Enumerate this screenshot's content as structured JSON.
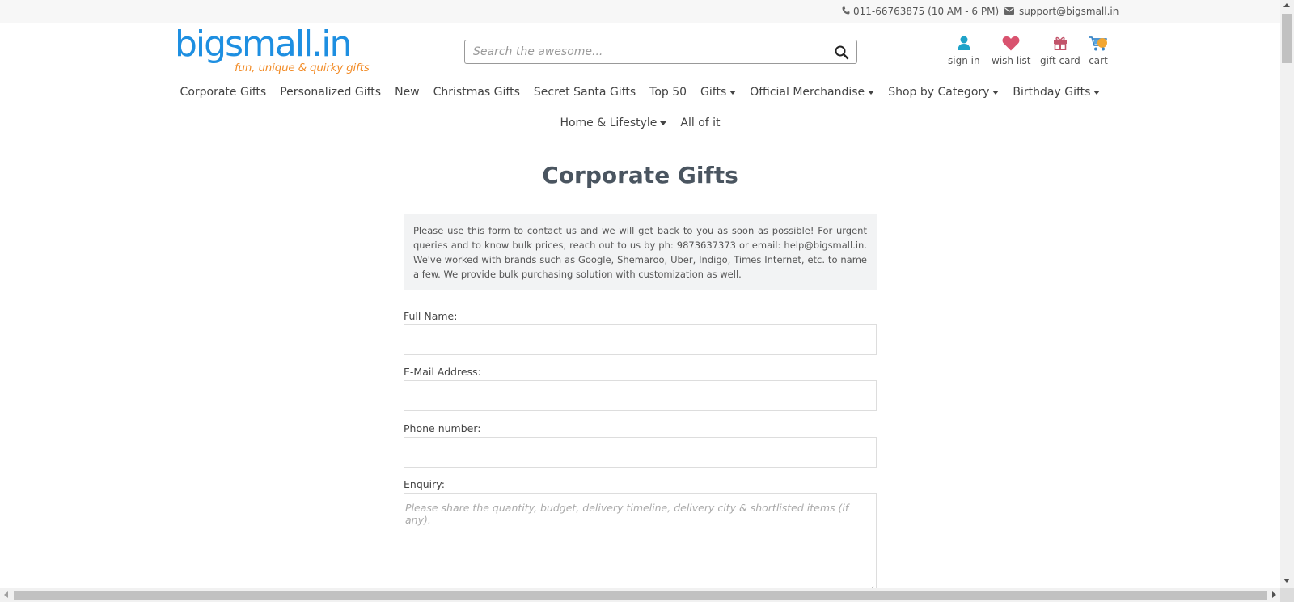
{
  "topbar": {
    "phone": "011-66763875 (10 AM - 6 PM)",
    "email": "support@bigsmall.in"
  },
  "logo": {
    "name": "bigsmall.in",
    "tagline": "fun, unique & quirky gifts"
  },
  "search": {
    "placeholder": "Search the awesome..."
  },
  "quick_links": {
    "sign_in": "sign in",
    "wish_list": "wish list",
    "gift_card": "gift card",
    "cart": "cart"
  },
  "nav": {
    "row1": [
      {
        "label": "Corporate Gifts",
        "dropdown": false
      },
      {
        "label": "Personalized Gifts",
        "dropdown": false
      },
      {
        "label": "New",
        "dropdown": false
      },
      {
        "label": "Christmas Gifts",
        "dropdown": false
      },
      {
        "label": "Secret Santa Gifts",
        "dropdown": false
      },
      {
        "label": "Top 50",
        "dropdown": false
      },
      {
        "label": "Gifts",
        "dropdown": true
      },
      {
        "label": "Official Merchandise",
        "dropdown": true
      },
      {
        "label": "Shop by Category",
        "dropdown": true
      },
      {
        "label": "Birthday Gifts",
        "dropdown": true
      }
    ],
    "row2": [
      {
        "label": "Home & Lifestyle",
        "dropdown": true
      },
      {
        "label": "All of it",
        "dropdown": false
      }
    ]
  },
  "page": {
    "title": "Corporate Gifts",
    "intro": "Please use this form to contact us and we will get back to you as soon as possible! For urgent queries and to know bulk prices, reach out to us by ph: 9873637373 or email: help@bigsmall.in. We've worked with brands such as Google, Shemaroo, Uber, Indigo, Times Internet, etc. to name a few. We provide bulk purchasing solution with customization as well."
  },
  "form": {
    "full_name_label": "Full Name:",
    "full_name_value": "",
    "email_label": "E-Mail Address:",
    "email_value": "",
    "phone_label": "Phone number:",
    "phone_value": "",
    "enquiry_label": "Enquiry:",
    "enquiry_placeholder": "Please share the quantity, budget, delivery timeline, delivery city & shortlisted items (if any)."
  },
  "colors": {
    "brand_blue": "#1e8fe1",
    "brand_orange": "#f28c28",
    "user_icon": "#1fa3c9",
    "heart_icon": "#d9536f",
    "gift_icon": "#c2546a"
  }
}
